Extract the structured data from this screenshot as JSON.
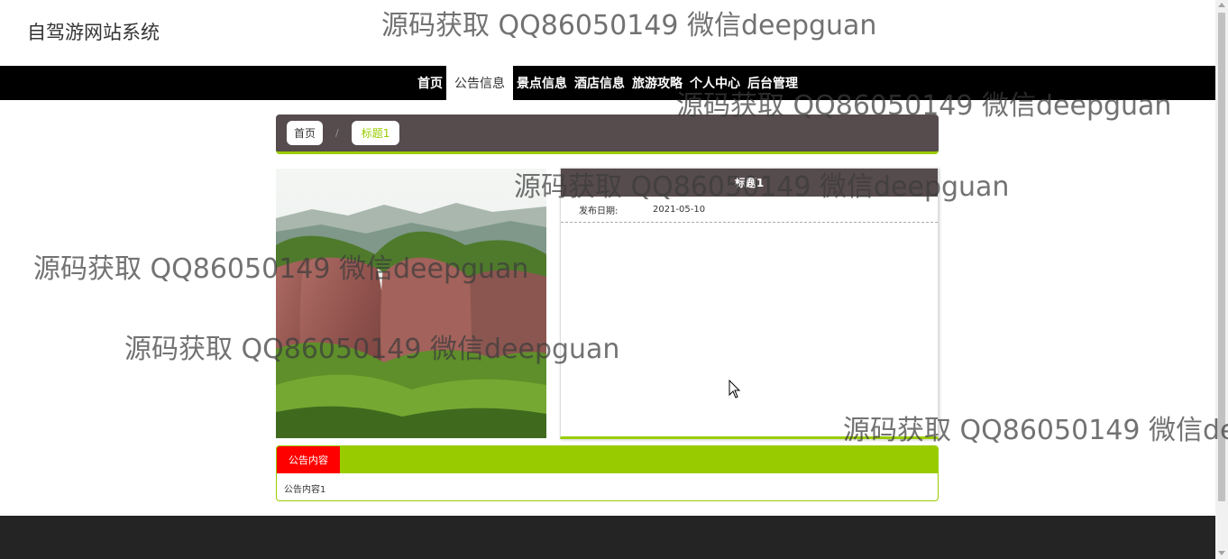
{
  "header": {
    "site_title": "自驾游网站系统"
  },
  "nav": {
    "items": [
      {
        "label": "首页"
      },
      {
        "label": "公告信息"
      },
      {
        "label": "景点信息"
      },
      {
        "label": "酒店信息"
      },
      {
        "label": "旅游攻略"
      },
      {
        "label": "个人中心"
      },
      {
        "label": "后台管理"
      }
    ],
    "active_index": 1
  },
  "breadcrumb": {
    "home": "首页",
    "separator": "/",
    "current": "标题1"
  },
  "detail": {
    "title": "标题1",
    "publish_date_label": "发布日期:",
    "publish_date": "2021-05-10"
  },
  "content_section": {
    "tab_label": "公告内容",
    "body": "公告内容1"
  },
  "watermarks": [
    "源码获取 QQ86050149 微信deepguan",
    "源码获取 QQ86050149 微信deepguan",
    "源码获取 QQ86050149 微信deepguan",
    "源码获取 QQ86050149 微信deepguan",
    "源码获取 QQ86050149 微信deepguan",
    "源码获取 QQ86050149 微信de"
  ],
  "colors": {
    "accent": "#99cc00",
    "header_panel": "#564b4d",
    "nav_bg": "#000000",
    "tab_red": "#ff0000",
    "footer": "#242424"
  }
}
